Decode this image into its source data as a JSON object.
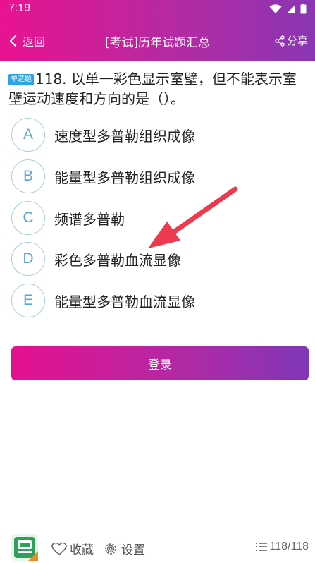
{
  "status_bar": {
    "time": "7:19"
  },
  "header": {
    "back_label": "返回",
    "title": "[考试]历年试题汇总",
    "share_label": "分享"
  },
  "question": {
    "type_badge": "单选题",
    "text": "118. 以单一彩色显示室壁，但不能表示室壁运动速度和方向的是（）。"
  },
  "options": [
    {
      "letter": "A",
      "text": "速度型多普勒组织成像"
    },
    {
      "letter": "B",
      "text": "能量型多普勒组织成像"
    },
    {
      "letter": "C",
      "text": "频谱多普勒"
    },
    {
      "letter": "D",
      "text": "彩色多普勒血流显像"
    },
    {
      "letter": "E",
      "text": "能量型多普勒血流显像"
    }
  ],
  "login_label": "登录",
  "bottom_bar": {
    "favorite_label": "收藏",
    "settings_label": "设置",
    "progress": "118/118"
  },
  "colors": {
    "header_gradient_start": "#e8138f",
    "header_gradient_end": "#8a36b3",
    "option_circle": "#58a9d0",
    "arrow": "#ee3a4f",
    "badge": "#2aa4e6"
  },
  "icons": {
    "back": "chevron-left-icon",
    "share": "share-icon",
    "favorite": "heart-outline-icon",
    "settings": "gear-icon",
    "progress": "list-icon",
    "annotation": "red-arrow-icon"
  }
}
